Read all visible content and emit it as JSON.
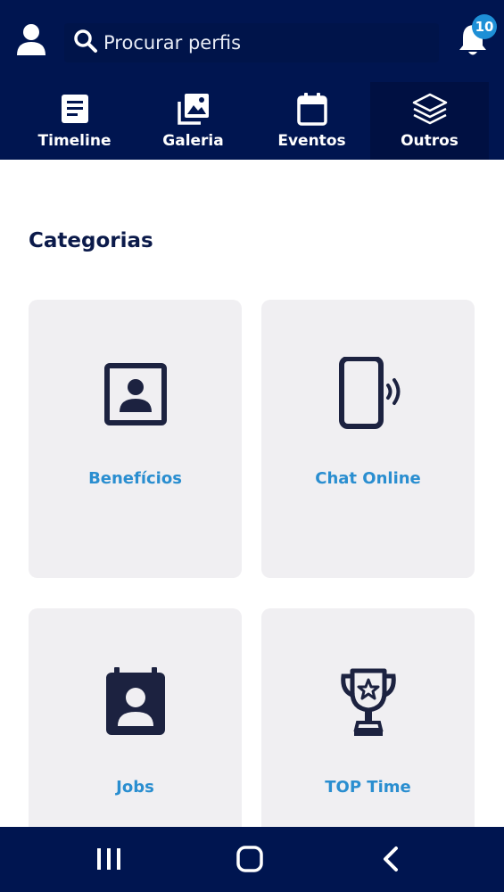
{
  "header": {
    "profile_icon": "person-icon",
    "search": {
      "placeholder": "Procurar perfis",
      "icon": "search-icon"
    },
    "notifications": {
      "icon": "bell-icon",
      "count": "10"
    }
  },
  "tabs": [
    {
      "label": "Timeline",
      "icon": "document-icon",
      "active": false
    },
    {
      "label": "Galeria",
      "icon": "gallery-icon",
      "active": false
    },
    {
      "label": "Eventos",
      "icon": "calendar-icon",
      "active": false
    },
    {
      "label": "Outros",
      "icon": "layers-icon",
      "active": true
    }
  ],
  "content": {
    "section_title": "Categorias",
    "cards": [
      {
        "label": "Benefícios",
        "icon": "profile-card-icon"
      },
      {
        "label": "Chat Online",
        "icon": "phone-signal-icon"
      },
      {
        "label": "Jobs",
        "icon": "badge-person-icon"
      },
      {
        "label": "TOP Time",
        "icon": "trophy-icon"
      }
    ]
  },
  "navbar": {
    "recent_icon": "recent-apps-icon",
    "home_icon": "home-icon",
    "back_icon": "back-icon"
  },
  "colors": {
    "header_bg": "#001550",
    "active_tab_bg": "#001042",
    "card_bg": "#f0eff2",
    "card_label": "#2a8ed0",
    "title": "#0b1a4a",
    "icon_dark": "#1c2240",
    "badge": "#1e8fd6"
  }
}
